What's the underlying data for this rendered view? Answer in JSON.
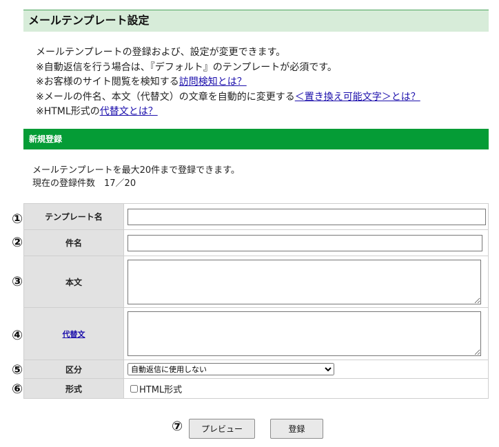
{
  "page": {
    "title": "メールテンプレート設定"
  },
  "intro": {
    "line1": "メールテンプレートの登録および、設定が変更できます。",
    "line2": "※自動返信を行う場合は、『デフォルト』のテンプレートが必須です。",
    "line3_text": "※お客様のサイト閲覧を検知する",
    "line3_link": "訪問検知とは？",
    "line4_text": "※メールの件名、本文（代替文）の文章を自動的に変更する",
    "line4_link": "＜置き換え可能文字＞とは？",
    "line5_text": "※HTML形式の",
    "line5_link": "代替文とは？"
  },
  "section": {
    "title": "新規登録"
  },
  "limit": {
    "line1": "メールテンプレートを最大20件まで登録できます。",
    "line2": "現在の登録件数　17／20"
  },
  "form": {
    "template_name_label": "テンプレート名",
    "subject_label": "件名",
    "body_label": "本文",
    "alt_text_label": "代替文",
    "category_label": "区分",
    "category_selected": "自動返信に使用しない",
    "format_label": "形式",
    "format_html": "HTML形式"
  },
  "markers": [
    "①",
    "②",
    "③",
    "④",
    "⑤",
    "⑥",
    "⑦"
  ],
  "buttons": {
    "preview": "プレビュー",
    "register": "登録"
  }
}
